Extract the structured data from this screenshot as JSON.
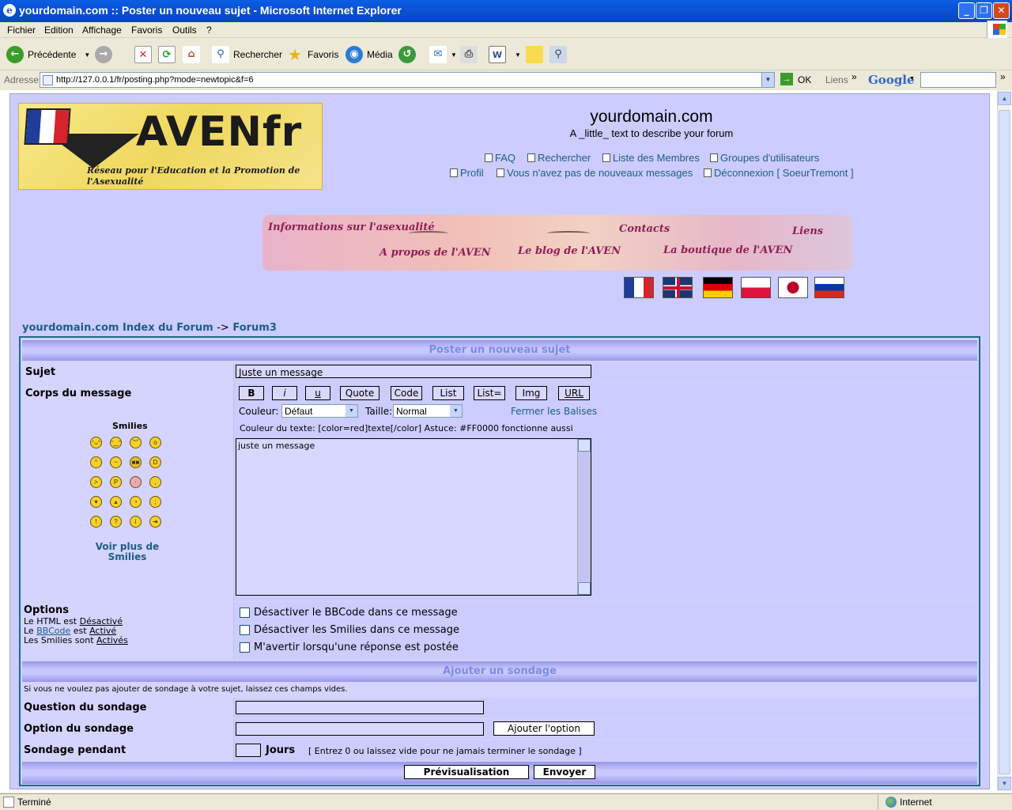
{
  "window": {
    "title": "yourdomain.com :: Poster un nouveau sujet - Microsoft Internet Explorer"
  },
  "menu": [
    "Fichier",
    "Edition",
    "Affichage",
    "Favoris",
    "Outils",
    "?"
  ],
  "toolbar": {
    "back": "Précédente",
    "search": "Rechercher",
    "favorites": "Favoris",
    "media": "Média"
  },
  "address": {
    "label": "Adresse",
    "url": "http://127.0.0.1/fr/posting.php?mode=newtopic&f=6",
    "go": "OK",
    "links": "Liens",
    "google": "Google"
  },
  "header": {
    "logo_name": "AVENfr",
    "logo_sub": "Réseau pour l'Education et la Promotion de l'Asexualité",
    "site_name": "yourdomain.com",
    "site_desc": "A _little_ text to describe your forum",
    "links": {
      "faq": "FAQ",
      "search": "Rechercher",
      "members": "Liste des Membres",
      "groups": "Groupes d'utilisateurs",
      "profile": "Profil",
      "messages": "Vous n'avez pas de nouveaux messages",
      "logout": "Déconnexion [ SoeurTremont ]"
    }
  },
  "banner": {
    "info": "Informations sur l'asexualité",
    "contacts": "Contacts",
    "liens": "Liens",
    "apropos": "A propos de l'AVEN",
    "blog": "Le blog de l'AVEN",
    "boutique": "La boutique de l'AVEN"
  },
  "breadcrumb": {
    "index": "yourdomain.com Index du Forum",
    "sep": "->",
    "forum": "Forum3"
  },
  "post": {
    "header": "Poster un nouveau sujet",
    "subject_label": "Sujet",
    "subject_value": "Juste un message",
    "body_label": "Corps du message",
    "bbcode_buttons": [
      "B",
      "i",
      "u",
      "Quote",
      "Code",
      "List",
      "List=",
      "Img",
      "URL"
    ],
    "color_label": "Couleur:",
    "color_value": "Défaut",
    "size_label": "Taille:",
    "size_value": "Normal",
    "close_tags": "Fermer les Balises",
    "help_line": "Couleur du texte: [color=red]texte[/color] Astuce: #FF0000 fonctionne aussi",
    "message": "juste un message",
    "smilies_title": "Smilies",
    "more_smilies": "Voir plus de Smilies",
    "options_label": "Options",
    "html_line": [
      "Le HTML est ",
      "Désactivé"
    ],
    "bbcode_line": [
      "Le ",
      "BBCode",
      " est ",
      "Activé"
    ],
    "smilies_line": [
      "Les Smilies sont ",
      "Activés"
    ],
    "opt_bbcode": "Désactiver le BBCode dans ce message",
    "opt_smilies": "Désactiver les Smilies dans ce message",
    "opt_notify": "M'avertir lorsqu'une réponse est postée"
  },
  "poll": {
    "header": "Ajouter un sondage",
    "hint": "Si vous ne voulez pas ajouter de sondage à votre sujet, laissez ces champs vides.",
    "question_label": "Question du sondage",
    "option_label": "Option du sondage",
    "add_option": "Ajouter l'option",
    "length_label": "Sondage pendant",
    "days": "Jours",
    "length_hint": "[ Entrez 0 ou laissez vide pour ne jamais terminer le sondage ]"
  },
  "actions": {
    "preview": "Prévisualisation",
    "submit": "Envoyer"
  },
  "status": {
    "left": "Terminé",
    "zone": "Internet"
  }
}
